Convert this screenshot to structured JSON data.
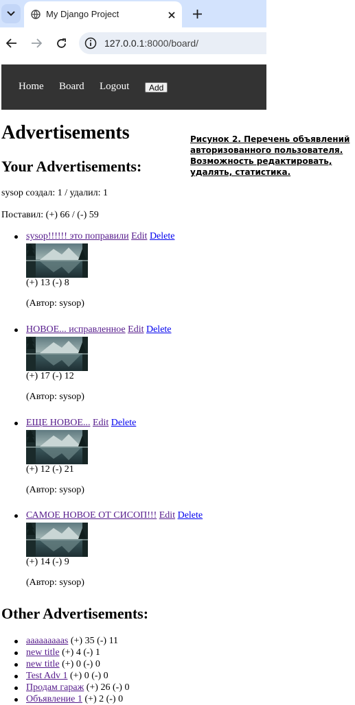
{
  "browser": {
    "tab_title": "My Django Project",
    "url_host": "127.0.0.1",
    "url_rest": ":8000/board/"
  },
  "nav": {
    "home": "Home",
    "board": "Board",
    "logout": "Logout",
    "add": "Add"
  },
  "page": {
    "title": "Advertisements",
    "your_heading": "Your Advertisements:",
    "stats_created": "sysop создал: 1 / удалил: 1",
    "stats_votes": "Поставил: (+) 66 / (-) 59",
    "other_heading": "Other Advertisements:"
  },
  "annotation": "Рисунок 2. Перечень объявлений авторизованного пользователя. Возможность редактировать, удалять, статистика.",
  "my_ads": [
    {
      "title": "sysop!!!!!! это поправили",
      "edit": "Edit",
      "delete": "Delete",
      "score": "(+) 13 (-) 8",
      "author": "(Автор: sysop)"
    },
    {
      "title": "НОВОЕ... исправленное",
      "edit": "Edit",
      "delete": "Delete",
      "score": "(+) 17 (-) 12",
      "author": "(Автор: sysop)"
    },
    {
      "title": "ЕЩЕ НОВОЕ...",
      "edit": "Edit",
      "delete": "Delete",
      "score": "(+) 12 (-) 21",
      "author": "(Автор: sysop)"
    },
    {
      "title": "САМОЕ НОВОЕ ОТ СИСОП!!!",
      "edit": "Edit",
      "delete": "Delete",
      "score": "(+) 14 (-) 9",
      "author": "(Автор: sysop)"
    }
  ],
  "other_ads": [
    {
      "title": "aaaaaaaaas",
      "score": "(+) 35 (-) 11"
    },
    {
      "title": "new title",
      "score": "(+) 4 (-) 1"
    },
    {
      "title": "new title",
      "score": "(+) 0 (-) 0"
    },
    {
      "title": "Test Adv 1",
      "score": "(+) 0 (-) 0"
    },
    {
      "title": "Продам гараж",
      "score": "(+) 26 (-) 0"
    },
    {
      "title": "Объявление 1",
      "score": "(+) 2 (-) 0"
    }
  ]
}
